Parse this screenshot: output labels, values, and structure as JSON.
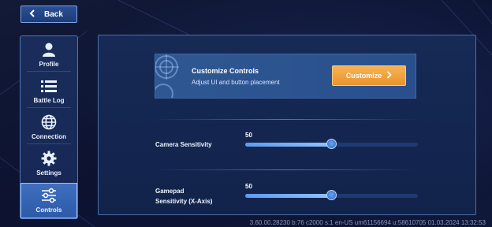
{
  "back": {
    "label": "Back"
  },
  "sidebar": {
    "items": [
      {
        "label": "Profile",
        "icon": "person-icon",
        "active": false
      },
      {
        "label": "Battle Log",
        "icon": "list-icon",
        "active": false
      },
      {
        "label": "Connection",
        "icon": "globe-icon",
        "active": false
      },
      {
        "label": "Settings",
        "icon": "gear-icon",
        "active": false
      },
      {
        "label": "Controls",
        "icon": "sliders-icon",
        "active": true
      }
    ]
  },
  "customize": {
    "title": "Customize Controls",
    "subtitle": "Adjust UI and button placement",
    "button_label": "Customize"
  },
  "settings": [
    {
      "label": "Camera Sensitivity",
      "value": "50",
      "fraction": 0.5
    },
    {
      "label": "Gamepad\nSensitivity (X-Axis)",
      "value": "50",
      "fraction": 0.5
    }
  ],
  "footer": {
    "text": "3.60.00.28230 b:76 c2000 s:1 en-US um61156694 u:58610705 01.03.2024 13:32:53"
  },
  "colors": {
    "accent_orange": "#f0a23f",
    "slider_fill": "#6fa9f5",
    "active_tab": "#3462b0"
  }
}
